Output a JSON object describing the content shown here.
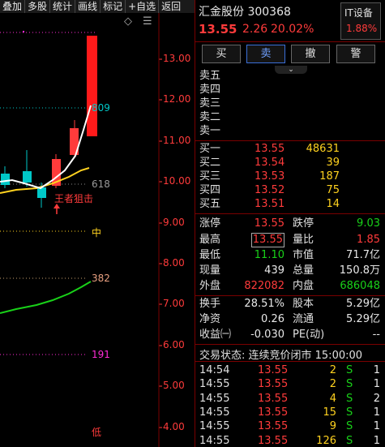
{
  "toolbar": {
    "items": [
      "叠加",
      "多股",
      "统计",
      "画线",
      "标记",
      "+自选",
      "返回"
    ]
  },
  "chart": {
    "price_ticks": [
      "13.00",
      "12.00",
      "11.00",
      "10.00",
      "9.00",
      "8.00",
      "7.00",
      "6.00",
      "5.00",
      "4.00"
    ],
    "level_labels": [
      "809",
      "618",
      "中",
      "382",
      "191",
      "低"
    ],
    "annotation": "王者狙击",
    "diamond_icon": "◇",
    "menu_icon": "☰"
  },
  "stock": {
    "name_code": "汇金股份 300368",
    "price": "13.55",
    "change": "2.26",
    "change_pct": "20.02%",
    "sector_name": "IT设备",
    "sector_pct": "1.88%"
  },
  "actions": [
    "买",
    "卖",
    "撤",
    "警"
  ],
  "sell_book": [
    {
      "label": "卖五"
    },
    {
      "label": "卖四"
    },
    {
      "label": "卖三"
    },
    {
      "label": "卖二"
    },
    {
      "label": "卖一"
    }
  ],
  "buy_book": [
    {
      "label": "买一",
      "price": "13.55",
      "vol": "48631"
    },
    {
      "label": "买二",
      "price": "13.54",
      "vol": "39"
    },
    {
      "label": "买三",
      "price": "13.53",
      "vol": "187"
    },
    {
      "label": "买四",
      "price": "13.52",
      "vol": "75"
    },
    {
      "label": "买五",
      "price": "13.51",
      "vol": "14"
    }
  ],
  "stats": {
    "limit_up_label": "涨停",
    "limit_up": "13.55",
    "limit_down_label": "跌停",
    "limit_down": "9.03",
    "high_label": "最高",
    "high": "13.55",
    "vol_ratio_label": "量比",
    "vol_ratio": "1.85",
    "low_label": "最低",
    "low": "11.10",
    "mkt_cap_label": "市值",
    "mkt_cap": "71.7亿",
    "cur_vol_label": "现量",
    "cur_vol": "439",
    "total_vol_label": "总量",
    "total_vol": "150.8万",
    "outer_label": "外盘",
    "outer": "822082",
    "inner_label": "内盘",
    "inner": "686048",
    "turnover_label": "换手",
    "turnover": "28.51%",
    "shares_label": "股本",
    "shares": "5.29亿",
    "nav_label": "净资",
    "nav": "0.26",
    "float_label": "流通",
    "float": "5.29亿",
    "eps_label": "收益㈠",
    "eps": "-0.030",
    "pe_label": "PE(动)",
    "pe": "--"
  },
  "trade_status": "交易状态: 连续竞价闭市 15:00:00",
  "ticks": [
    {
      "time": "14:54",
      "price": "13.55",
      "vol": "2",
      "side": "S",
      "n": "1"
    },
    {
      "time": "14:55",
      "price": "13.55",
      "vol": "2",
      "side": "S",
      "n": "1"
    },
    {
      "time": "14:55",
      "price": "13.55",
      "vol": "4",
      "side": "S",
      "n": "2"
    },
    {
      "time": "14:55",
      "price": "13.55",
      "vol": "15",
      "side": "S",
      "n": "1"
    },
    {
      "time": "14:55",
      "price": "13.55",
      "vol": "9",
      "side": "S",
      "n": "1"
    },
    {
      "time": "14:55",
      "price": "13.55",
      "vol": "126",
      "side": "S",
      "n": "1"
    }
  ],
  "colors": {
    "up": "#ff3b3b",
    "down": "#19d119",
    "neutral": "#e8e8e8",
    "cyan": "#00c8c8",
    "yellow": "#ffd21f",
    "magenta": "#ff2bd6",
    "separator": "#7a0000"
  }
}
